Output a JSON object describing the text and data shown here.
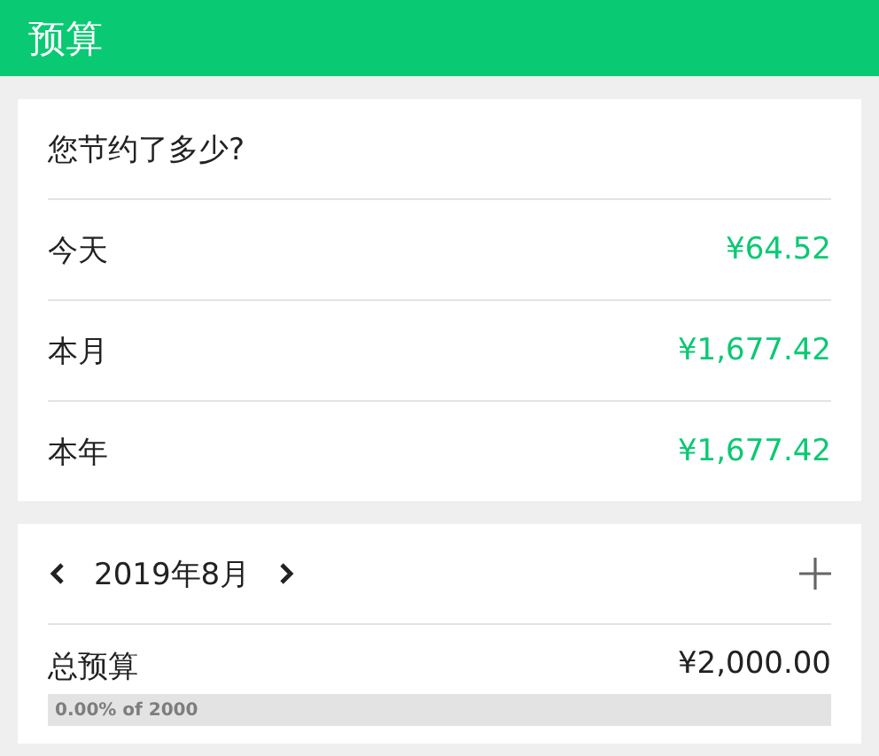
{
  "app_bar": {
    "title": "预算"
  },
  "savings": {
    "title": "您节约了多少?",
    "rows": [
      {
        "label": "今天",
        "amount": "¥64.52"
      },
      {
        "label": "本月",
        "amount": "¥1,677.42"
      },
      {
        "label": "本年",
        "amount": "¥1,677.42"
      }
    ]
  },
  "budget": {
    "month": "2019年8月",
    "items": [
      {
        "label": "总预算",
        "amount": "¥2,000.00",
        "progress_text": "0.00% of 2000"
      }
    ]
  }
}
